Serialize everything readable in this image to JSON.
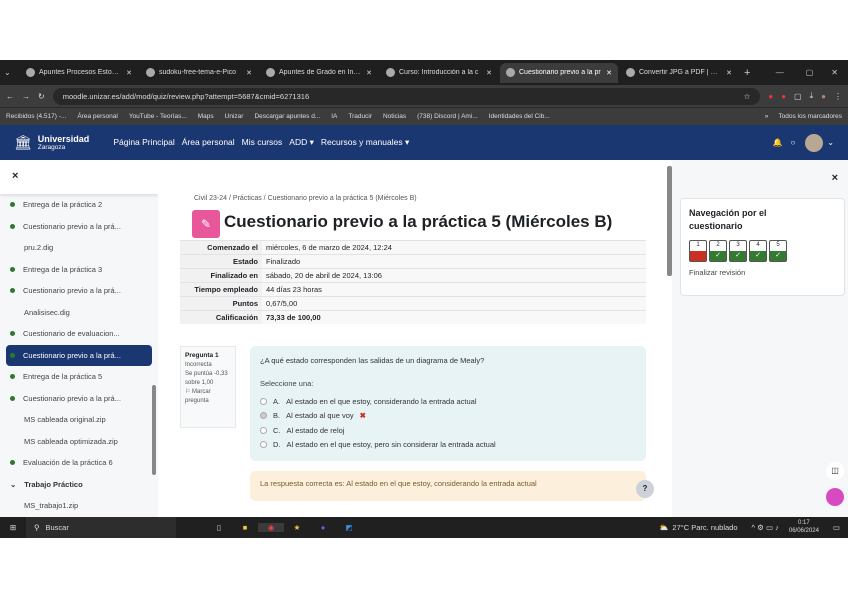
{
  "browser": {
    "tabs": [
      {
        "label": "Apuntes Procesos Estocást"
      },
      {
        "label": "sudoku-free-tema-e-Pico"
      },
      {
        "label": "Apuntes de Grado en Ingen"
      },
      {
        "label": "Curso: Introducción a la c"
      },
      {
        "label": "Cuestionario previo a la pr",
        "active": true
      },
      {
        "label": "Convertir JPG a PDF | Onli"
      }
    ],
    "url": "moodle.unizar.es/add/mod/quiz/review.php?attempt=5687&cmid=6271316",
    "bookmarks": [
      "Recibidos (4.517) -...",
      "Área personal",
      "YouTube - Teorías...",
      "Maps",
      "Unizar",
      "Descargar apuntes d...",
      "IA",
      "Traducir",
      "Noticias",
      "(738) Discord | Ami...",
      "Identidades del Cib..."
    ],
    "all_bookmarks": "Todos los marcadores"
  },
  "navbar": {
    "logo_title": "Universidad",
    "logo_sub": "Zaragoza",
    "links": [
      "Página Principal",
      "Área personal",
      "Mis cursos",
      "ADD ▾",
      "Recursos y manuales ▾"
    ]
  },
  "sidebar": {
    "close": "×",
    "items": [
      {
        "label": "Entrega de la práctica 2",
        "dot": true
      },
      {
        "label": "Cuestionario previo a la prá...",
        "dot": true
      },
      {
        "label": "pru.2.dig",
        "dot": false
      },
      {
        "label": "Entrega de la práctica 3",
        "dot": true
      },
      {
        "label": "Cuestionario previo a la prá...",
        "dot": true
      },
      {
        "label": "Analisisec.dig",
        "dot": false
      },
      {
        "label": "Cuestionario de evaluacion...",
        "dot": true
      },
      {
        "label": "Cuestionario previo a la prá...",
        "dot": true,
        "selected": true
      },
      {
        "label": "Entrega de la práctica 5",
        "dot": true
      },
      {
        "label": "Cuestionario previo a la prá...",
        "dot": true
      },
      {
        "label": "MS cableada original.zip",
        "dot": false
      },
      {
        "label": "MS cableada optimizada.zip",
        "dot": false
      },
      {
        "label": "Evaluación de la práctica 6",
        "dot": true
      }
    ],
    "section": "Trabajo Práctico",
    "section_item": "MS_trabajo1.zip"
  },
  "main": {
    "breadcrumb": [
      "Civil 23-24",
      "Prácticas",
      "Cuestionario previo a la práctica 5 (Miércoles B)"
    ],
    "title": "Cuestionario previo a la práctica 5 (Miércoles B)",
    "summary": [
      {
        "k": "Comenzado el",
        "v": "miércoles, 6 de marzo de 2024, 12:24"
      },
      {
        "k": "Estado",
        "v": "Finalizado"
      },
      {
        "k": "Finalizado en",
        "v": "sábado, 20 de abril de 2024, 13:06"
      },
      {
        "k": "Tiempo empleado",
        "v": "44 días 23 horas"
      },
      {
        "k": "Puntos",
        "v": "0,67/5,00"
      },
      {
        "k": "Calificación",
        "v": "73,33 de 100,00"
      }
    ],
    "qinfo": {
      "title": "Pregunta 1",
      "state": "Incorrecta",
      "score": "Se puntúa -0,33 sobre 1,00",
      "flag": "Marcar pregunta"
    },
    "question": "¿A qué estado corresponden las salidas de un diagrama de Mealy?",
    "select_one": "Seleccione una:",
    "options": [
      {
        "letter": "A.",
        "text": "Al estado en el que estoy, considerando la entrada actual"
      },
      {
        "letter": "B.",
        "text": "Al estado al que voy",
        "wrong": true
      },
      {
        "letter": "C.",
        "text": "Al estado de reloj"
      },
      {
        "letter": "D.",
        "text": "Al estado en el que estoy, pero sin considerar la entrada actual"
      }
    ],
    "feedback": "La respuesta correcta es: Al estado en el que estoy, considerando la entrada actual",
    "help": "?"
  },
  "right": {
    "close": "×",
    "title": "Navegación por el cuestionario",
    "questions": [
      {
        "n": "1",
        "status": "incorrect"
      },
      {
        "n": "2",
        "status": "correct"
      },
      {
        "n": "3",
        "status": "correct"
      },
      {
        "n": "4",
        "status": "correct"
      },
      {
        "n": "5",
        "status": "correct"
      }
    ],
    "finish": "Finalizar revisión"
  },
  "taskbar": {
    "search": "Buscar",
    "weather": "27°C Parc. nublado",
    "time": "0:17",
    "date": "06/06/2024"
  },
  "colors": {
    "navbar": "#1b3771",
    "incorrect": "#ca3120",
    "correct": "#357a32",
    "quiz_icon": "#e8569b"
  }
}
